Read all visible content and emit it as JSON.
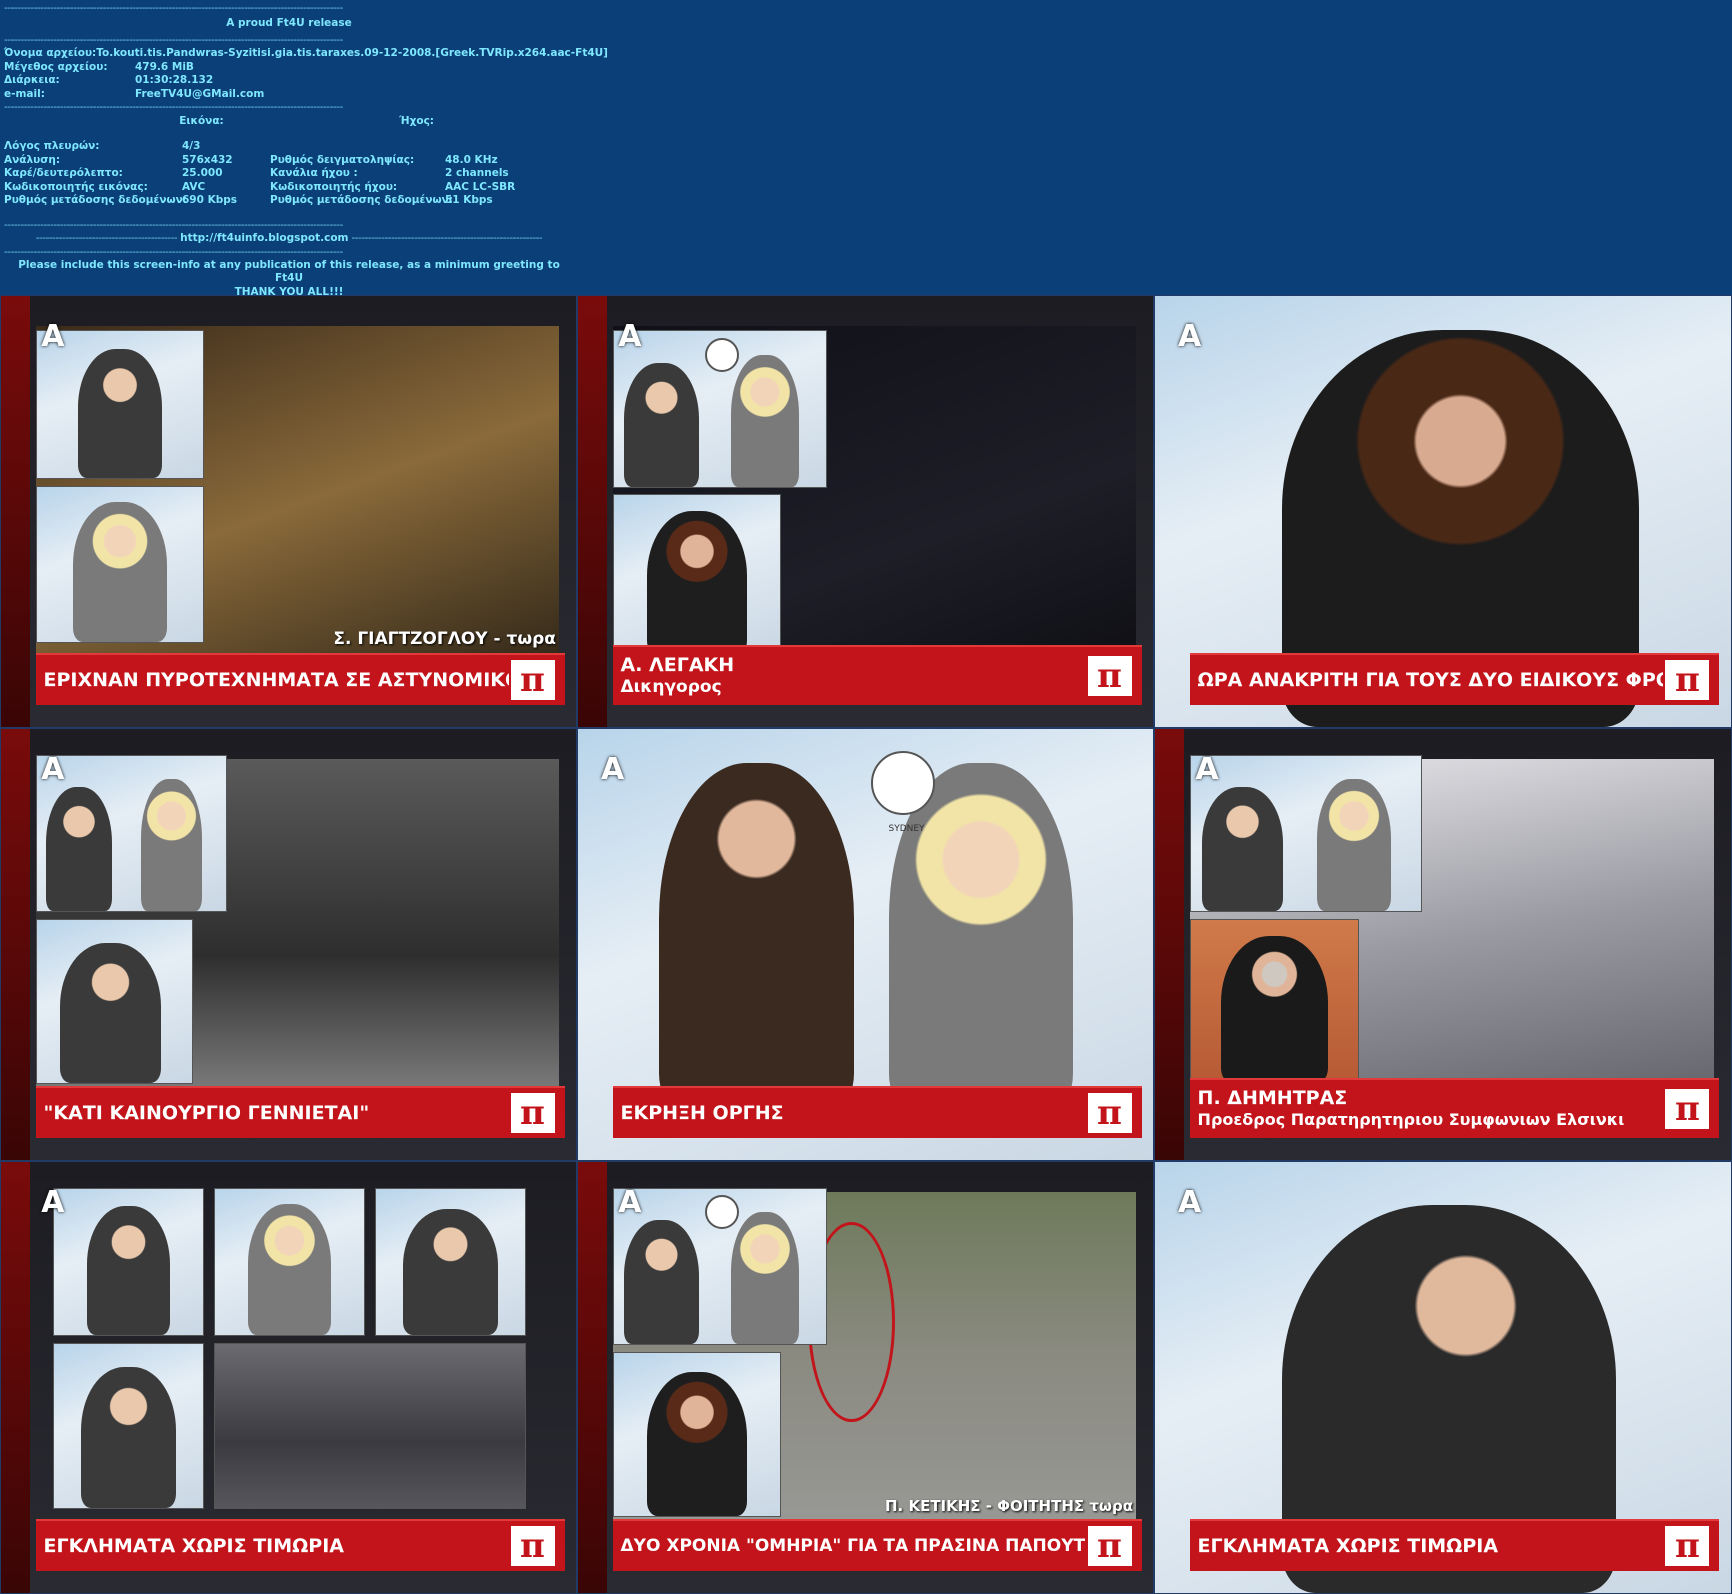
{
  "info": {
    "dash_line": "-------------------------------------------------------------------------------------------------------",
    "title": "A proud Ft4U release",
    "file_rows": [
      {
        "key": "Όνομα αρχείου:",
        "value": "To.kouti.tis.Pandwras-Syzitisi.gia.tis.taraxes.09-12-2008.[Greek.TVRip.x264.aac-Ft4U]"
      },
      {
        "key": "Μέγεθος αρχείου:",
        "value": "479.6 MiB"
      },
      {
        "key": "Διάρκεια:",
        "value": "01:30:28.132"
      },
      {
        "key": "e-mail:",
        "value": "FreeTV4U@GMail.com"
      }
    ],
    "video_header": "Εικόνα:",
    "audio_header": "Ήχος:",
    "tech_rows": [
      {
        "lkey": "Λόγος πλευρών:",
        "lval": "4/3",
        "rkey": "",
        "rval": ""
      },
      {
        "lkey": "Ανάλυση:",
        "lval": "576x432",
        "rkey": "Ρυθμός δειγματοληψίας:",
        "rval": "48.0 KHz"
      },
      {
        "lkey": "Καρέ/δευτερόλεπτο:",
        "lval": "25.000",
        "rkey": "Κανάλια ήχου :",
        "rval": "2 channels"
      },
      {
        "lkey": "Κωδικοποιητής εικόνας:",
        "lval": "AVC",
        "rkey": "Κωδικοποιητής ήχου:",
        "rval": "AAC LC-SBR"
      },
      {
        "lkey": "Ρυθμός μετάδοσης δεδομένων:",
        "lval": "690 Kbps",
        "rkey": "Ρυθμός μετάδοσης δεδομένων:",
        "rval": "51 Kbps"
      }
    ],
    "url_left": "-------------------------------------------",
    "url": "http://ft4uinfo.blogspot.com",
    "url_right": "----------------------------------------------------------",
    "footer_line1": "Please include this screen-info at any publication of this release, as a minimum greeting to Ft4U",
    "footer_line2": "THANK YOU ALL!!!"
  },
  "channel_logo": "A",
  "show_logo": "π",
  "frames": [
    {
      "caption": "ΕΡΙΧΝΑΝ ΠΥΡΟΤΕΧΝΗΜΑΤΑ ΣΕ ΑΣΤΥΝΟΜΙΚΟΥΣ",
      "nameplate": "Σ. ΓΙΑΓΤΖΟΓΛΟΥ - τωρα"
    },
    {
      "caption": "Α. ΛΕΓΑΚΗ",
      "caption2": "Δικηγορος"
    },
    {
      "caption": "ΩΡΑ ΑΝΑΚΡΙΤΗ ΓΙΑ ΤΟΥΣ ΔΥΟ ΕΙΔΙΚΟΥΣ ΦΡΟΥΡΟΥΣ"
    },
    {
      "caption": "\"ΚΑΤΙ ΚΑΙΝΟΥΡΓΙΟ ΓΕΝΝΙΕΤΑΙ\""
    },
    {
      "caption": "ΕΚΡΗΞΗ ΟΡΓΗΣ",
      "clock_label": "SYDNEY"
    },
    {
      "caption": "Π. ΔΗΜΗΤΡΑΣ",
      "caption2": "Προεδρος Παρατηρητηριου Συμφωνιων Ελσινκι"
    },
    {
      "caption": "ΕΓΚΛΗΜΑΤΑ ΧΩΡΙΣ ΤΙΜΩΡΙΑ"
    },
    {
      "caption": "ΔΥΟ ΧΡΟΝΙΑ \"ΟΜΗΡΙΑ\" ΓΙΑ ΤΑ ΠΡΑΣΙΝΑ ΠΑΠΟΥΤΣΙΑ",
      "nameplate": "Π. ΚΕΤΙΚΗΣ - ΦΟΙΤΗΤΗΣ τωρα"
    },
    {
      "caption": "ΕΓΚΛΗΜΑΤΑ ΧΩΡΙΣ ΤΙΜΩΡΙΑ"
    }
  ]
}
